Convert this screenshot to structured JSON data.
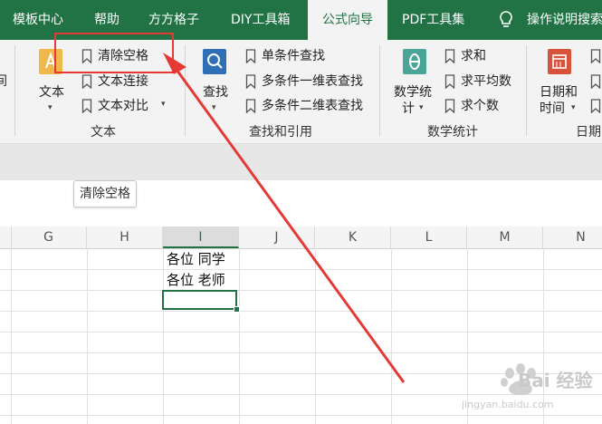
{
  "tabs": [
    "模板中心",
    "帮助",
    "方方格子",
    "DIY工具箱",
    "公式向导",
    "PDF工具集",
    "操作说明搜索"
  ],
  "active_tab": "公式向导",
  "ribbon": {
    "left_cut_label": "间",
    "text_group": {
      "big_button": "文本",
      "items": [
        "清除空格",
        "文本连接",
        "文本对比"
      ],
      "label": "文本"
    },
    "lookup_group": {
      "big_button": "查找",
      "items": [
        "单条件查找",
        "多条件一维表查找",
        "多条件二维表查找"
      ],
      "label": "查找和引用"
    },
    "math_group": {
      "big_button_line1": "数学统",
      "big_button_line2": "计",
      "items": [
        "求和",
        "求平均数",
        "求个数"
      ],
      "label": "数学统计"
    },
    "date_group": {
      "big_button_line1": "日期和",
      "big_button_line2": "时间",
      "label_cut": "日期"
    }
  },
  "tooltip": "清除空格",
  "columns": [
    "G",
    "H",
    "I",
    "J",
    "K",
    "L",
    "M",
    "N"
  ],
  "selected_column": "I",
  "cells": [
    "各位 同学",
    "各位 老师"
  ],
  "watermark": {
    "brand": "Bai 经验",
    "url": "jingyan.baidu.com"
  },
  "colors": {
    "excel_green": "#217346",
    "annotation_red": "#e53935",
    "ribbon_bg": "#f3f3f3"
  }
}
